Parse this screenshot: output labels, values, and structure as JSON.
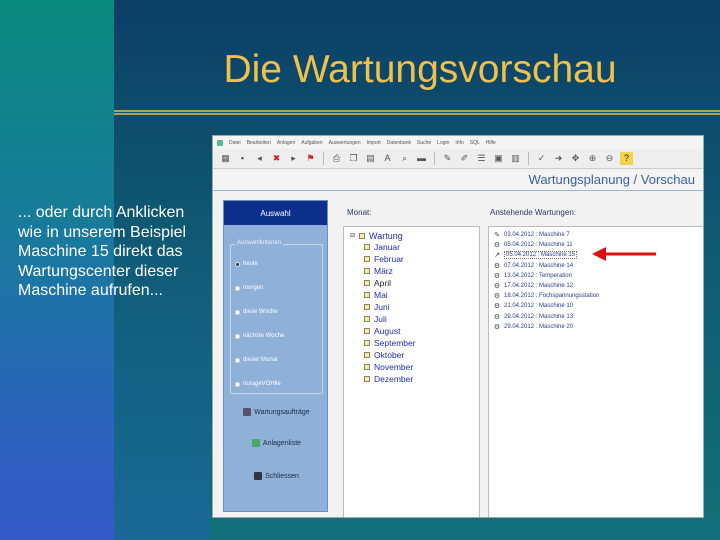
{
  "slide": {
    "title": "Die Wartungsvorschau",
    "text": "... oder durch Anklicken wie in unserem Beispiel Maschine 15 direkt das Wartungscenter dieser Maschine aufrufen..."
  },
  "app": {
    "menu_items": [
      "Datei",
      "Bearbeiten",
      "Anlagen",
      "Aufgaben",
      "Auswertungen",
      "Import",
      "Datenbank",
      "Suche",
      "Login",
      "Info",
      "SQL",
      "Hilfe"
    ],
    "toolbar_icons": [
      "grid-icon",
      "save-icon",
      "back-icon",
      "delete-icon",
      "forward-icon",
      "flag-icon",
      "print-icon",
      "copy-icon",
      "paste-icon",
      "text-icon",
      "search-icon",
      "ruler-icon",
      "pen-icon",
      "edit-icon",
      "list-icon",
      "calendar-icon",
      "calc-icon",
      "check-icon",
      "arrow-icon",
      "move-icon",
      "zoom-icon",
      "zoom-out-icon",
      "help-icon"
    ],
    "header_title": "Wartungsplanung / Vorschau",
    "auswahl": {
      "title": "Auswahl",
      "group_label": "Auswahlkriterien",
      "options": [
        {
          "label": "heute",
          "checked": true
        },
        {
          "label": "morgen",
          "checked": false
        },
        {
          "label": "diese Woche",
          "checked": false
        },
        {
          "label": "nächste Woche",
          "checked": false
        },
        {
          "label": "dieser Monat",
          "checked": false
        },
        {
          "label": "nurageVOHlle",
          "checked": false
        }
      ],
      "buttons": [
        "Wartungsaufträge",
        "Anlagenliste",
        "Schliessen"
      ]
    },
    "monat": {
      "label": "Monat:",
      "root": "Wartung",
      "months": [
        "Januar",
        "Februar",
        "März",
        "April",
        "Mai",
        "Juni",
        "Juli",
        "August",
        "September",
        "Oktober",
        "November",
        "Dezember"
      ],
      "selected": "April"
    },
    "wartungen": {
      "label": "Anstehende Wartungen:",
      "items": [
        {
          "date": "03.04.2012",
          "machine": "Maschine 7"
        },
        {
          "date": "05.04.2012",
          "machine": "Maschine 11"
        },
        {
          "date": "05.04.2012",
          "machine": "Maschine 15",
          "selected": true
        },
        {
          "date": "07.04.2012",
          "machine": "Maschine 14"
        },
        {
          "date": "13.04.2012",
          "machine": "Temperation"
        },
        {
          "date": "17.04.2012",
          "machine": "Maschine 12"
        },
        {
          "date": "18.04.2012",
          "machine": "Fochspannungsstation"
        },
        {
          "date": "21.04.2012",
          "machine": "Maschine 10"
        },
        {
          "date": "29.04.2012",
          "machine": "Maschine 13"
        },
        {
          "date": "29.04.2012",
          "machine": "Maschine 20"
        }
      ]
    }
  },
  "colors": {
    "title": "#f0c14a",
    "accent": "#0d2f8c",
    "arrow": "#e01010"
  }
}
